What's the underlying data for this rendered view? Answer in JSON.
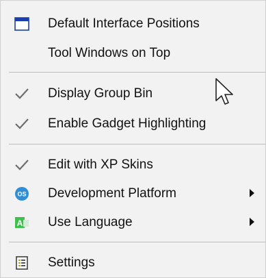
{
  "menu": {
    "items": [
      {
        "label": "Default Interface Positions",
        "icon": "window-icon"
      },
      {
        "label": "Tool Windows on Top",
        "icon": ""
      },
      {
        "label": "Display Group Bin",
        "icon": "check-icon",
        "checked": true
      },
      {
        "label": "Enable Gadget Highlighting",
        "icon": "check-icon",
        "checked": true
      },
      {
        "label": "Edit with XP Skins",
        "icon": "check-icon",
        "checked": true
      },
      {
        "label": "Development Platform",
        "icon": "os-icon",
        "icon_text": "OS",
        "submenu": true
      },
      {
        "label": "Use Language",
        "icon": "language-icon",
        "icon_text": "A",
        "submenu": true
      },
      {
        "label": "Settings",
        "icon": "settings-icon"
      }
    ]
  },
  "colors": {
    "background": "#f2f2f2",
    "separator": "#bdbdbd",
    "check": "#6e6e6e",
    "os_icon": "#2f8ed6",
    "language_icon": "#3fbf4e",
    "window_icon": "#1a3fa8"
  }
}
